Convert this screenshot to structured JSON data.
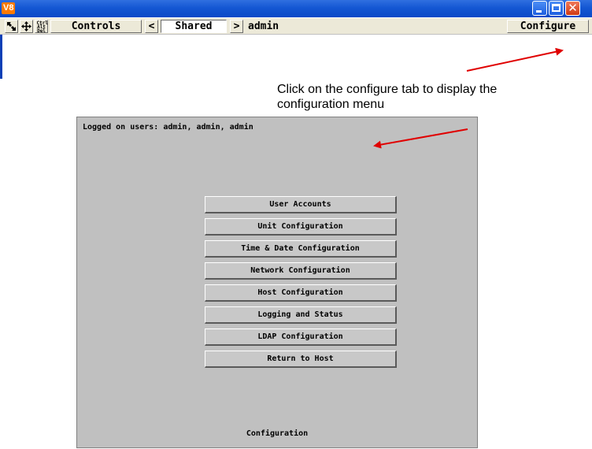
{
  "window": {
    "logo": "V8",
    "close_glyph": "✕"
  },
  "toolbar": {
    "cad_label": "Ctrl Alt Del",
    "controls_label": "Controls",
    "prev_label": "<",
    "shared_label": "Shared",
    "next_label": ">",
    "user": "admin",
    "configure_label": "Configure"
  },
  "annotation": {
    "text": "Click on the configure tab to display the configuration menu"
  },
  "menu": {
    "logged_users": "Logged on users: admin, admin, admin",
    "items": [
      {
        "label": "User Accounts"
      },
      {
        "label": "Unit Configuration"
      },
      {
        "label": "Time & Date Configuration"
      },
      {
        "label": "Network Configuration"
      },
      {
        "label": "Host Configuration"
      },
      {
        "label": "Logging and Status"
      },
      {
        "label": "LDAP Configuration"
      },
      {
        "label": "Return to Host"
      }
    ],
    "footer": "Configuration"
  },
  "colors": {
    "titlebar": "#1457d3",
    "panel_bg": "#c0c0c0",
    "arrow": "#e00000"
  },
  "icons": {
    "resize": "resize-arrows-icon",
    "move": "move-icon",
    "cad": "ctrl-alt-del-icon"
  }
}
